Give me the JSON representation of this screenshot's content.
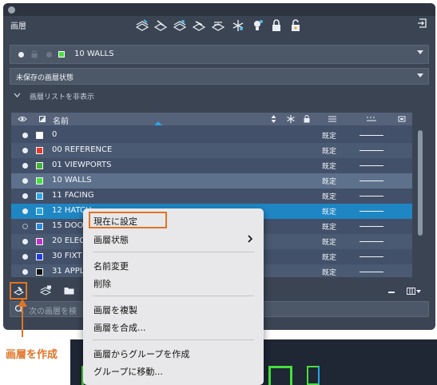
{
  "panel": {
    "title": "画層"
  },
  "current_layer": {
    "name": "10 WALLS"
  },
  "layer_state": {
    "label": "未保存の画層状態"
  },
  "collapse": {
    "label": "画層リストを非表示"
  },
  "header": {
    "name_col": "名前"
  },
  "layers": [
    {
      "name": "0",
      "color": "#ffffff",
      "type": "既定",
      "on": true
    },
    {
      "name": "00 REFERENCE",
      "color": "#e53b2c",
      "type": "既定",
      "on": true
    },
    {
      "name": "01 VIEWPORTS",
      "color": "#3fb431",
      "type": "既定",
      "on": true
    },
    {
      "name": "10 WALLS",
      "color": "#46e03c",
      "type": "既定",
      "on": true
    },
    {
      "name": "11 FACING",
      "color": "#2aa6e8",
      "type": "既定",
      "on": true
    },
    {
      "name": "12 HATCH",
      "color": "#2aa6e8",
      "type": "既定",
      "on": true
    },
    {
      "name": "15 DOOR",
      "color": "#2a8ad8",
      "type": "既定",
      "on": false
    },
    {
      "name": "20 ELEC",
      "color": "#c032c8",
      "type": "既定",
      "on": true
    },
    {
      "name": "30 FIXT",
      "color": "#1f3fd8",
      "type": "既定",
      "on": true
    },
    {
      "name": "31 APPL",
      "color": "#111111",
      "type": "既定",
      "on": true
    }
  ],
  "search": {
    "placeholder": "次の画層を検"
  },
  "context_menu": {
    "set_current": "現在に設定",
    "layer_state": "画層状態",
    "rename": "名前変更",
    "delete": "削除",
    "duplicate": "画層を複製",
    "merge": "画層を合成...",
    "create_group": "画層からグループを作成",
    "move_to_group": "グループに移動..."
  },
  "callout": {
    "label": "画層を作成"
  },
  "colors": {
    "accent": "#e07426",
    "selection": "#1f86c4",
    "panel": "#3b4453"
  }
}
